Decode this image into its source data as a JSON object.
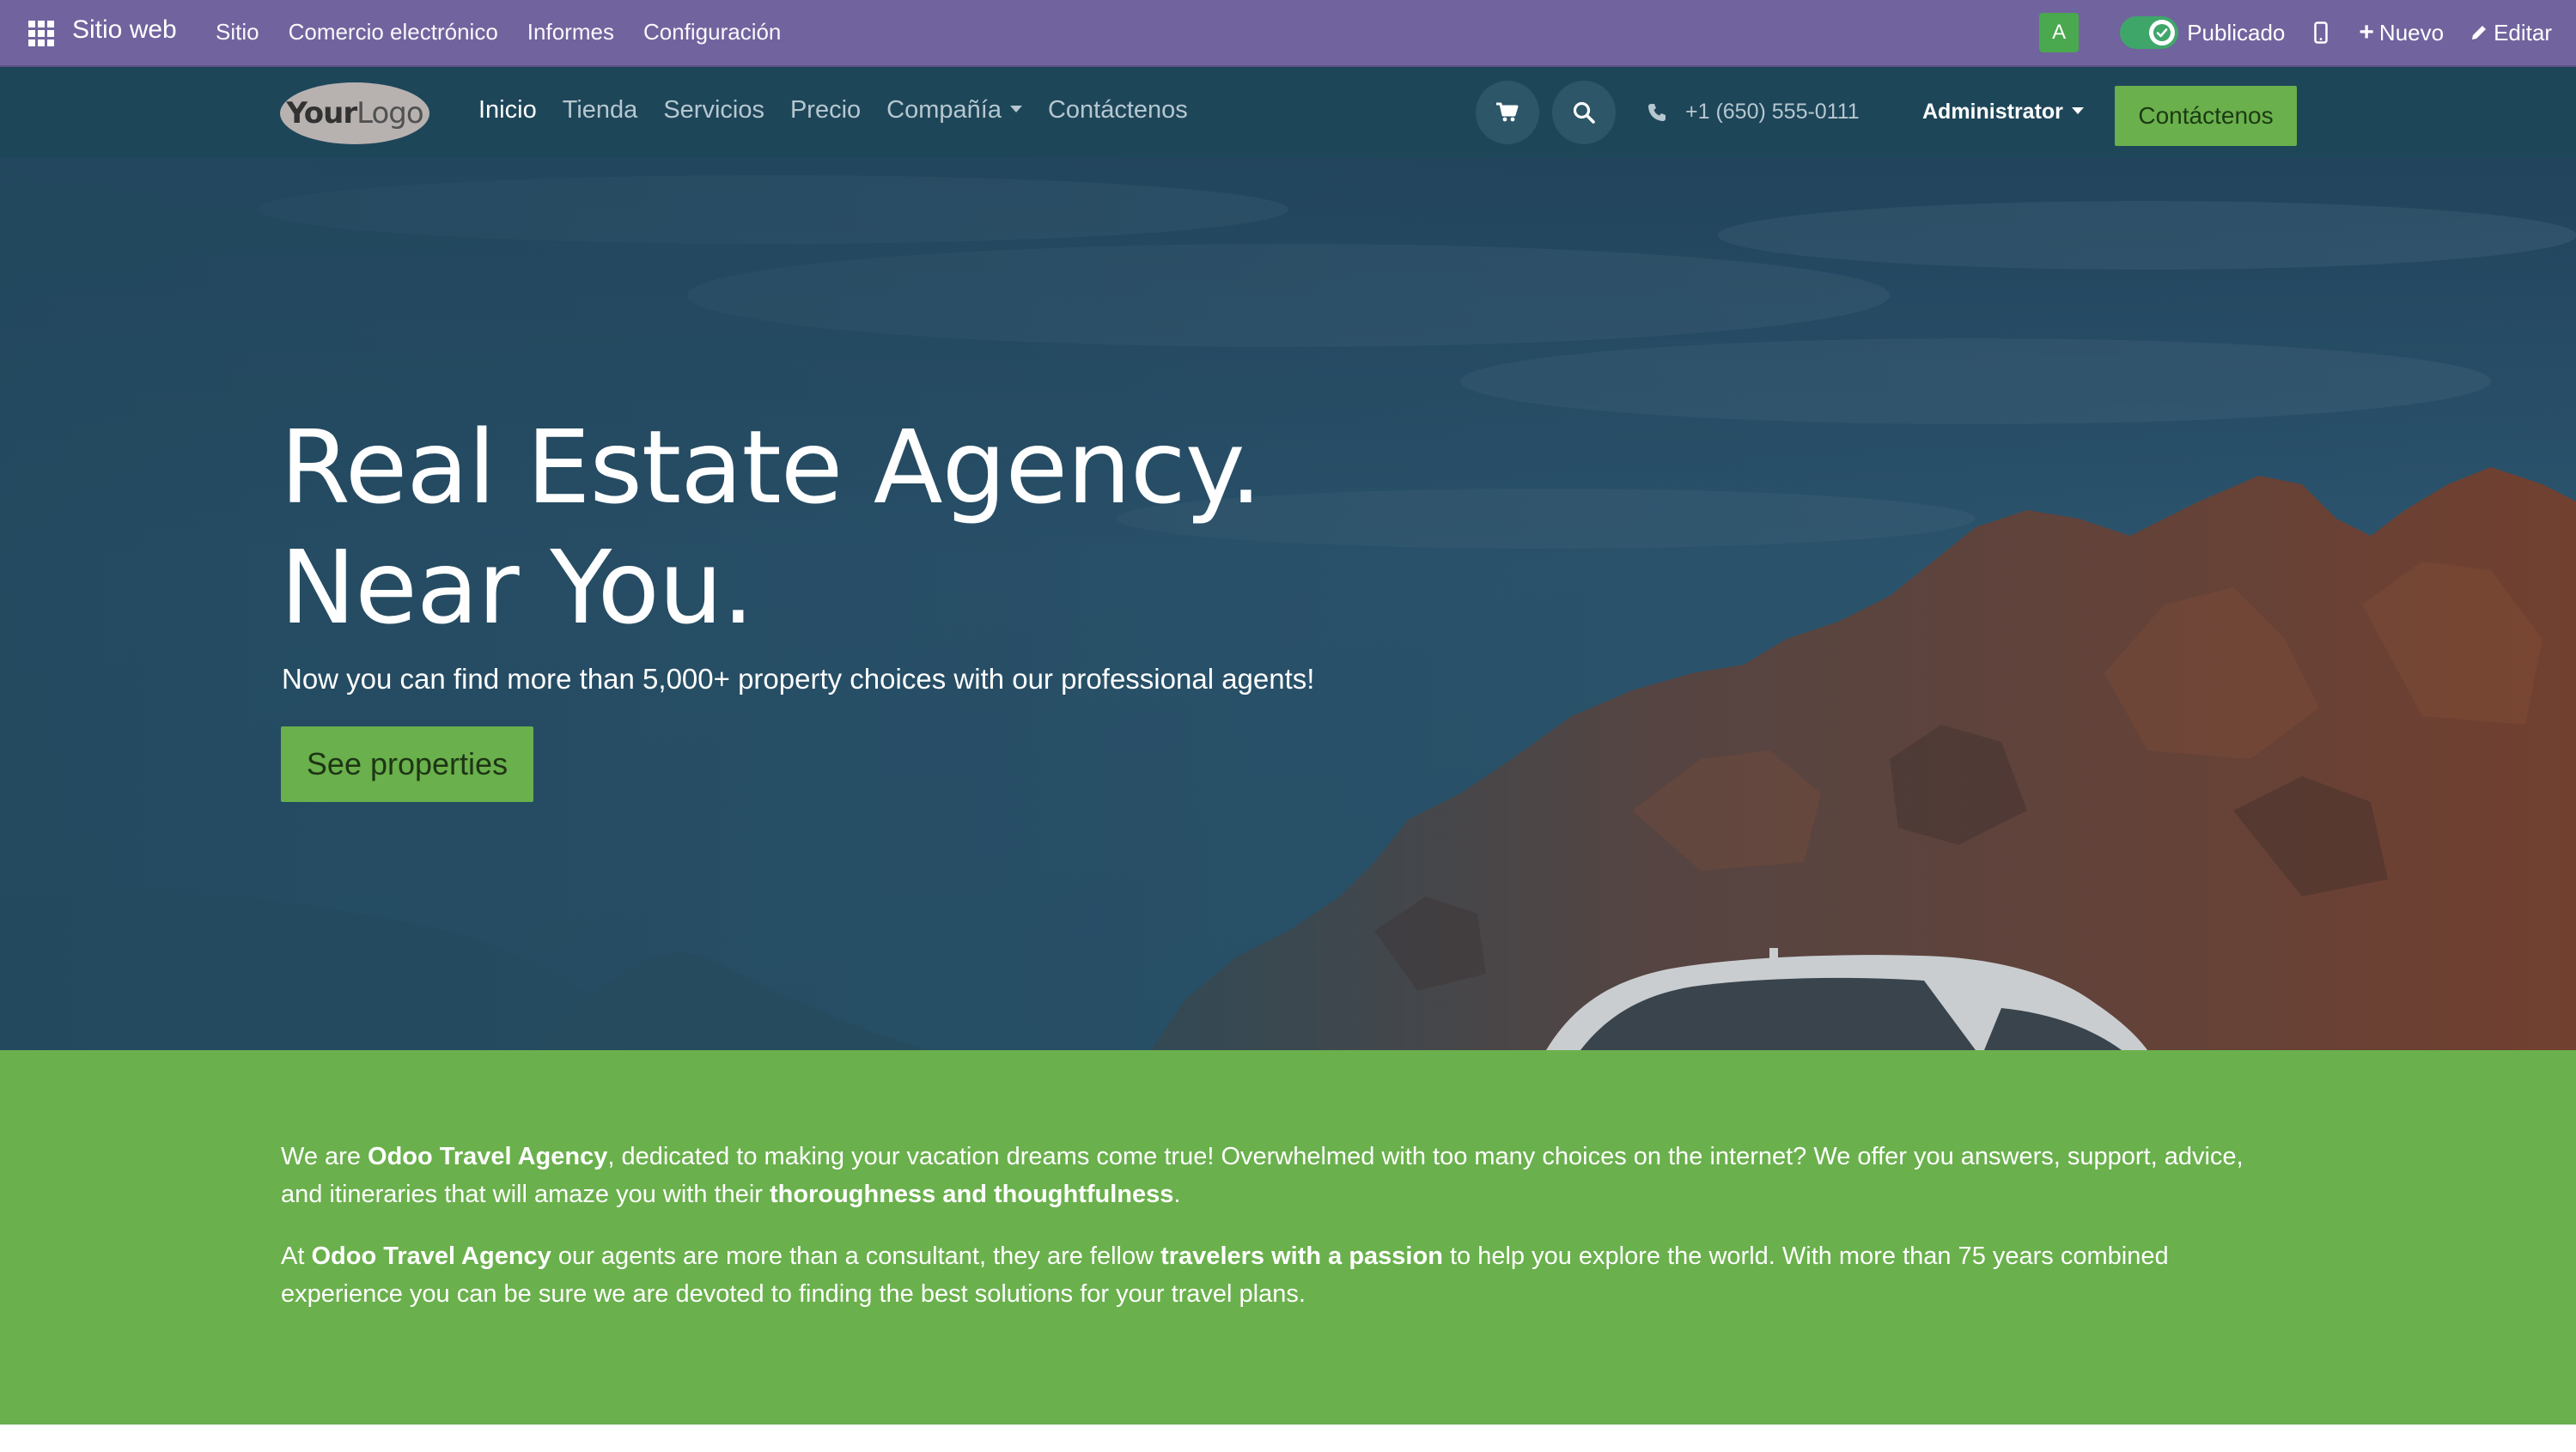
{
  "adminbar": {
    "app_name": "Sitio web",
    "menu": [
      "Sitio",
      "Comercio electrónico",
      "Informes",
      "Configuración"
    ],
    "avatar_letter": "A",
    "published_label": "Publicado",
    "published": true,
    "new_label": "Nuevo",
    "edit_label": "Editar",
    "bar_color": "#71639e"
  },
  "navbar": {
    "logo_your": "Your",
    "logo_logo": "Logo",
    "links": [
      "Inicio",
      "Tienda",
      "Servicios",
      "Precio",
      "Compañía",
      "Contáctenos"
    ],
    "active_link": "Inicio",
    "phone": "+1 (650) 555-0111",
    "user": "Administrator",
    "cta": "Contáctenos",
    "bg_color": "#1e4659",
    "accent": "#6ab04c"
  },
  "hero": {
    "title_line1": "Real Estate Agency.",
    "title_line2": "Near You.",
    "subtitle": "Now you can find more than 5,000+ property choices with our professional agents!",
    "button": "See properties"
  },
  "intro": {
    "p1": [
      {
        "t": "We are ",
        "b": false
      },
      {
        "t": "Odoo Travel Agency",
        "b": true
      },
      {
        "t": ", dedicated to making your vacation dreams come true! Overwhelmed with too many choices on the internet? We offer you answers, support, advice, and itineraries that will amaze you with their ",
        "b": false
      },
      {
        "t": "thoroughness and thoughtfulness",
        "b": true
      },
      {
        "t": ".",
        "b": false
      }
    ],
    "p2": [
      {
        "t": "At ",
        "b": false
      },
      {
        "t": "Odoo Travel Agency",
        "b": true
      },
      {
        "t": " our agents are more than a consultant, they are fellow ",
        "b": false
      },
      {
        "t": "travelers with a passion",
        "b": true
      },
      {
        "t": " to help you explore the world. With more than 75 years combined experience you can be sure we are devoted to finding the best solutions for your travel plans.",
        "b": false
      }
    ]
  }
}
